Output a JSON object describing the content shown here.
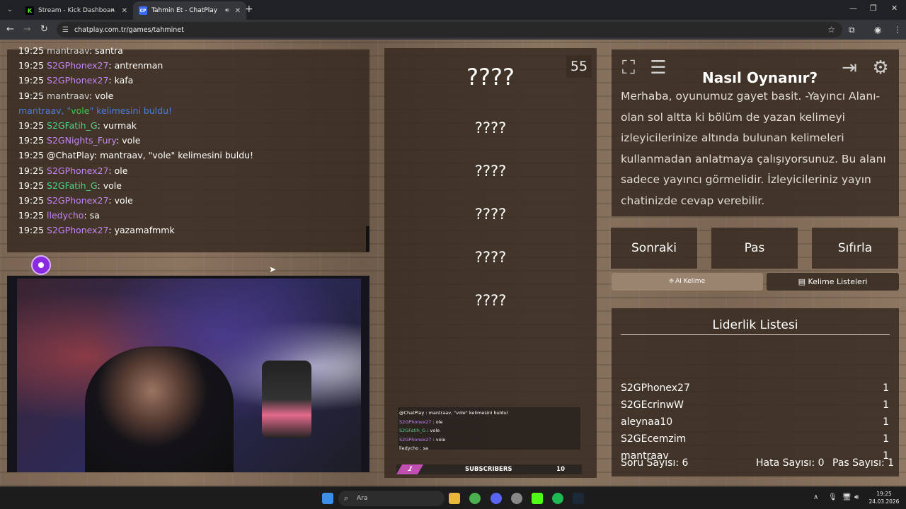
{
  "browser": {
    "tabs": [
      {
        "title": "Stream - Kick Dashboard",
        "favicon": "K",
        "favicon_color": "#53fc18",
        "muted": true
      },
      {
        "title": "Tahmin Et - ChatPlay",
        "favicon": "CP",
        "favicon_color": "#3b6cf6",
        "audio": true
      }
    ],
    "new_tab": "+",
    "url": "chatplay.com.tr/games/tahminet"
  },
  "chat_log": {
    "lines": [
      {
        "time": "19:25",
        "user": "mantraav",
        "msg": "santra",
        "color": "gray"
      },
      {
        "time": "19:25",
        "user": "S2GPhonex27",
        "msg": "antrenman",
        "color": "purple"
      },
      {
        "time": "19:25",
        "user": "S2GPhonex27",
        "msg": "kafa",
        "color": "purple"
      },
      {
        "time": "19:25",
        "user": "mantraav",
        "msg": "vole",
        "color": "gray"
      },
      {
        "system": true,
        "pre": "mantraav, \"",
        "word": "vole",
        "post": "\" kelimesini buldu!"
      },
      {
        "time": "19:25",
        "user": "S2GFatih_G",
        "msg": "vurmak",
        "color": "green"
      },
      {
        "time": "19:25",
        "user": "S2GNights_Fury",
        "msg": "vole",
        "color": "purple"
      },
      {
        "time": "19:25",
        "user": "@ChatPlay",
        "msg": "mantraav, \"vole\" kelimesini buldu!",
        "color": "white"
      },
      {
        "time": "19:25",
        "user": "S2GPhonex27",
        "msg": "ole",
        "color": "purple"
      },
      {
        "time": "19:25",
        "user": "S2GFatih_G",
        "msg": "vole",
        "color": "green"
      },
      {
        "time": "19:25",
        "user": "S2GPhonex27",
        "msg": "vole",
        "color": "purple"
      },
      {
        "time": "19:25",
        "user": "lledycho",
        "msg": "sa",
        "color": "purple"
      },
      {
        "time": "19:25",
        "user": "S2GPhonex27",
        "msg": "yazamafmmk",
        "color": "purple"
      }
    ]
  },
  "game": {
    "timer": "55",
    "hidden_words": [
      "????",
      "????",
      "????",
      "????",
      "????",
      "????"
    ]
  },
  "overlay_chat": {
    "lines": [
      {
        "user": "@ChatPlay",
        "msg": " : mantraav, \"vole\" kelimesini buldu!"
      },
      {
        "user": "S2GPhonex27",
        "msg": " : ole"
      },
      {
        "user": "S2GFatih_G",
        "msg": " : vole"
      },
      {
        "user": "S2GPhonex27",
        "msg": " : vole"
      },
      {
        "user": "lledycho",
        "msg": " : sa"
      }
    ],
    "subs_tag": "1",
    "subs_label": "SUBSCRIBERS",
    "subs_count": "10"
  },
  "howto": {
    "title": "Nasıl Oynanır?",
    "text": "Merhaba, oyunumuz gayet basit. -Yayıncı Alanı- olan sol altta ki bölüm de yazan kelimeyi izleyicilerinize altında bulunan kelimeleri kullanmadan anlatmaya çalışıyorsunuz. Bu alanı sadece yayıncı görmelidir. İzleyicileriniz yayın chatinizde cevap verebilir."
  },
  "actions": {
    "next": "Sonraki",
    "pass": "Pas",
    "reset": "Sıfırla",
    "ai_word": "AI Kelime",
    "word_lists": "Kelime Listeleri"
  },
  "leaderboard": {
    "title": "Liderlik Listesi",
    "rows": [
      {
        "name": "S2GPhonex27",
        "score": "1"
      },
      {
        "name": "S2GEcrinwW",
        "score": "1"
      },
      {
        "name": "aleynaa10",
        "score": "1"
      },
      {
        "name": "S2GEcemzim",
        "score": "1"
      },
      {
        "name": "mantraav",
        "score": "1"
      }
    ],
    "question_count": "Soru Sayısı: 6",
    "error_count": "Hata Sayısı: 0",
    "pass_count": "Pas Sayısı: 1"
  },
  "taskbar": {
    "search": "Ara",
    "time": "19:25",
    "date": "24.03.2026"
  },
  "colors": {
    "panel": "#34281f",
    "username_purple": "#c585f5",
    "username_green": "#4fd28a",
    "system_blue": "#4d7de0"
  }
}
